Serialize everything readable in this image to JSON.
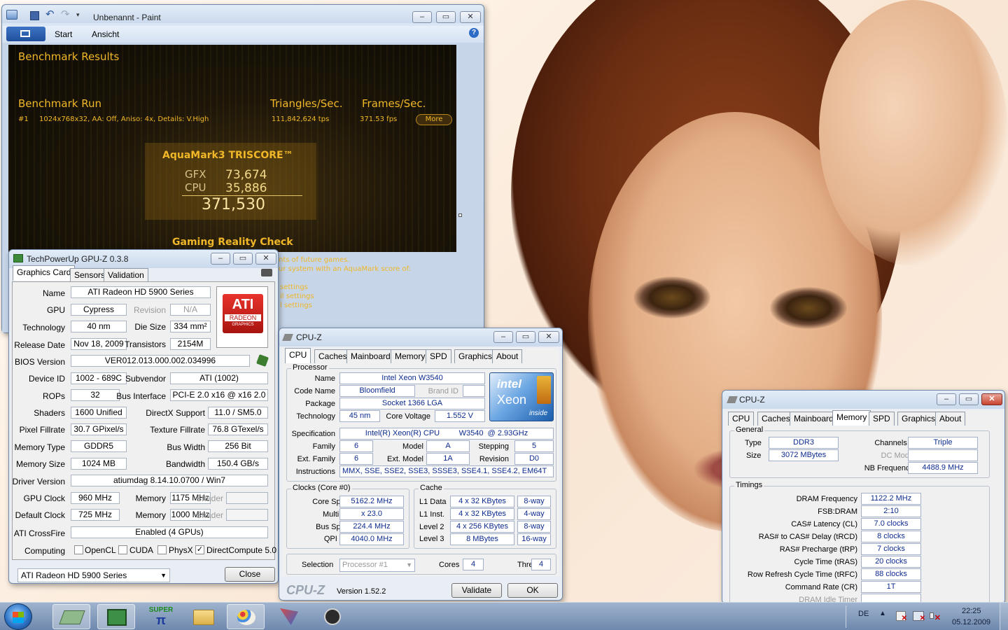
{
  "paint": {
    "title": "Unbenannt - Paint",
    "tabs": [
      "Start",
      "Ansicht"
    ]
  },
  "aquamark": {
    "header": "Benchmark Results",
    "run": "Benchmark Run",
    "col_tri": "Triangles/Sec.",
    "col_fps": "Frames/Sec.",
    "run_num": "#1",
    "run_desc": "1024x768x32, AA: Off, Aniso: 4x, Details: V.High",
    "tps": "111,842,624 tps",
    "fps": "371.53 fps",
    "more": "More",
    "triscore": "AquaMark3 TRISCORE™",
    "gfx_lbl": "GFX",
    "gfx": "73,674",
    "cpu_lbl": "CPU",
    "cpu": "35,886",
    "total": "371,530",
    "grc": "Gaming Reality Check",
    "l1": "nts of future games.",
    "l2": "ur system with an AquaMark score of:",
    "l3": "settings",
    "l4": "il settings",
    "l5": "l settings"
  },
  "gpuz": {
    "title": "TechPowerUp GPU-Z 0.3.8",
    "tabs": [
      "Graphics Card",
      "Sensors",
      "Validation"
    ],
    "labels": {
      "name": "Name",
      "gpu": "GPU",
      "revision": "Revision",
      "technology": "Technology",
      "die_size": "Die Size",
      "release_date": "Release Date",
      "transistors": "Transistors",
      "bios": "BIOS Version",
      "device_id": "Device ID",
      "subvendor": "Subvendor",
      "rops": "ROPs",
      "bus_interface": "Bus Interface",
      "shaders": "Shaders",
      "directx": "DirectX Support",
      "pixel_fill": "Pixel Fillrate",
      "texture_fill": "Texture Fillrate",
      "mem_type": "Memory Type",
      "bus_width": "Bus Width",
      "mem_size": "Memory Size",
      "bandwidth": "Bandwidth",
      "driver": "Driver Version",
      "gpu_clock": "GPU Clock",
      "memory": "Memory",
      "shader": "Shader",
      "default_clock": "Default Clock",
      "crossfire": "ATI CrossFire",
      "computing": "Computing"
    },
    "values": {
      "name": "ATI Radeon HD 5900 Series",
      "gpu": "Cypress",
      "revision": "N/A",
      "technology": "40 nm",
      "die_size": "334 mm²",
      "release_date": "Nov 18, 2009",
      "transistors": "2154M",
      "bios": "VER012.013.000.002.034996",
      "device_id": "1002 - 689C",
      "subvendor": "ATI (1002)",
      "rops": "32",
      "bus_interface": "PCI-E 2.0 x16 @ x16 2.0",
      "shaders": "1600 Unified",
      "directx": "11.0 / SM5.0",
      "pixel_fill": "30.7 GPixel/s",
      "texture_fill": "76.8 GTexel/s",
      "mem_type": "GDDR5",
      "bus_width": "256 Bit",
      "mem_size": "1024 MB",
      "bandwidth": "150.4 GB/s",
      "driver": "atiumdag 8.14.10.0700 / Win7",
      "gpu_clock": "960 MHz",
      "gpu_mem": "1175 MHz",
      "def_clock": "725 MHz",
      "def_mem": "1000 MHz",
      "crossfire": "Enabled (4 GPUs)"
    },
    "compute": [
      "OpenCL",
      "CUDA",
      "PhysX",
      "DirectCompute 5.0"
    ],
    "logo": {
      "l1": "ATI",
      "l2": "RADEON",
      "l3": "GRAPHICS"
    },
    "select": "ATI Radeon HD 5900 Series",
    "close": "Close"
  },
  "cpuz": {
    "title": "CPU-Z",
    "tabs": [
      "CPU",
      "Caches",
      "Mainboard",
      "Memory",
      "SPD",
      "Graphics",
      "About"
    ],
    "processor": {
      "group": "Processor",
      "name_l": "Name",
      "name": "Intel Xeon W3540",
      "code_l": "Code Name",
      "code": "Bloomfield",
      "brand_l": "Brand ID",
      "pkg_l": "Package",
      "pkg": "Socket 1366 LGA",
      "tech_l": "Technology",
      "tech": "45 nm",
      "volt_l": "Core Voltage",
      "volt": "1.552 V",
      "spec_l": "Specification",
      "spec": "Intel(R) Xeon(R) CPU         W3540  @ 2.93GHz",
      "fam_l": "Family",
      "fam": "6",
      "model_l": "Model",
      "model": "A",
      "step_l": "Stepping",
      "step": "5",
      "extfam_l": "Ext. Family",
      "extfam": "6",
      "extmod_l": "Ext. Model",
      "extmod": "1A",
      "rev_l": "Revision",
      "rev": "D0",
      "instr_l": "Instructions",
      "instr": "MMX, SSE, SSE2, SSE3, SSSE3, SSE4.1, SSE4.2, EM64T"
    },
    "clocks": {
      "group": "Clocks (Core #0)",
      "cs_l": "Core Speed",
      "cs": "5162.2 MHz",
      "mul_l": "Multiplier",
      "mul": "x 23.0",
      "bus_l": "Bus Speed",
      "bus": "224.4 MHz",
      "qpi_l": "QPI Link",
      "qpi": "4040.0 MHz"
    },
    "cache": {
      "group": "Cache",
      "l1d_l": "L1 Data",
      "l1d": "4 x 32 KBytes",
      "l1d_w": "8-way",
      "l1i_l": "L1 Inst.",
      "l1i": "4 x 32 KBytes",
      "l1i_w": "4-way",
      "l2_l": "Level 2",
      "l2": "4 x 256 KBytes",
      "l2_w": "8-way",
      "l3_l": "Level 3",
      "l3": "8 MBytes",
      "l3_w": "16-way"
    },
    "sel_l": "Selection",
    "sel": "Processor #1",
    "cores_l": "Cores",
    "cores": "4",
    "threads_l": "Threads",
    "threads": "4",
    "brand": "CPU-Z",
    "version": "Version 1.52.2",
    "validate": "Validate",
    "ok": "OK",
    "logo": {
      "l1": "intel",
      "l2": "Xeon",
      "l3": "inside"
    }
  },
  "cpuz2": {
    "title": "CPU-Z",
    "tabs": [
      "CPU",
      "Caches",
      "Mainboard",
      "Memory",
      "SPD",
      "Graphics",
      "About"
    ],
    "general": {
      "group": "General",
      "type_l": "Type",
      "type": "DDR3",
      "size_l": "Size",
      "size": "3072 MBytes",
      "ch_l": "Channels #",
      "ch": "Triple",
      "dc_l": "DC Mode",
      "nb_l": "NB Frequency",
      "nb": "4488.9 MHz"
    },
    "timings": {
      "group": "Timings",
      "rows": [
        {
          "l": "DRAM Frequency",
          "v": "1122.2 MHz"
        },
        {
          "l": "FSB:DRAM",
          "v": "2:10"
        },
        {
          "l": "CAS# Latency (CL)",
          "v": "7.0 clocks"
        },
        {
          "l": "RAS# to CAS# Delay (tRCD)",
          "v": "8 clocks"
        },
        {
          "l": "RAS# Precharge (tRP)",
          "v": "7 clocks"
        },
        {
          "l": "Cycle Time (tRAS)",
          "v": "20 clocks"
        },
        {
          "l": "Row Refresh Cycle Time (tRFC)",
          "v": "88 clocks"
        },
        {
          "l": "Command Rate (CR)",
          "v": "1T"
        },
        {
          "l": "DRAM Idle Timer",
          "v": ""
        }
      ]
    }
  },
  "taskbar": {
    "lang": "DE",
    "time": "22:25",
    "date": "05.12.2009",
    "super_l1": "SUPER",
    "super_l2": "π"
  },
  "colors": {
    "aq_gold": "#f0b728",
    "cpuz_blue": "#0c2b8e",
    "taskbar": "#7f97b9"
  }
}
